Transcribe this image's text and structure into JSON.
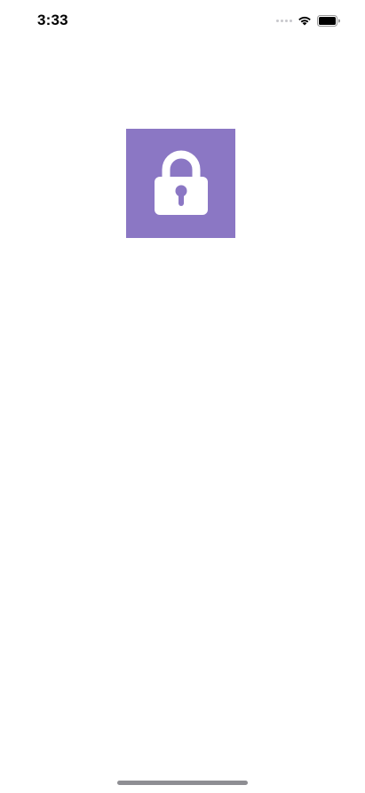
{
  "status_bar": {
    "time": "3:33",
    "icons": [
      "cellular-signal-icon",
      "wifi-icon",
      "battery-icon"
    ]
  },
  "main": {
    "tile_icon": "lock-icon",
    "tile_color": "#8b77c4"
  },
  "colors": {
    "background": "#ffffff",
    "accent": "#8b77c4",
    "home_indicator": "#8e8e93"
  }
}
